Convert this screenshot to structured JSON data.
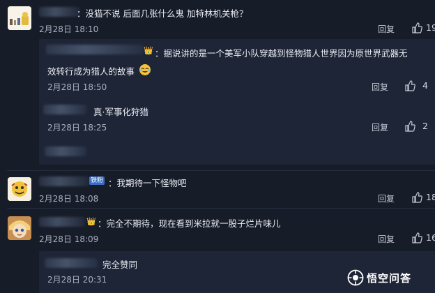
{
  "comments": [
    {
      "text": "：没猫不说 后面几张什么鬼 加特林机关枪？",
      "date": "2月28日 18:10",
      "reply_label": "回复",
      "likes": "19"
    },
    {
      "text": "：我期待一下怪物吧",
      "badge": "铁粉",
      "date": "2月28日 18:08",
      "reply_label": "回复",
      "likes": "18"
    },
    {
      "text": "：完全不期待，现在看到米拉就一股子烂片味儿",
      "date": "2月28日 18:09",
      "reply_label": "回复",
      "likes": "16"
    }
  ],
  "replies_1": [
    {
      "text_line1": "：据说讲的是一个美军小队穿越到怪物猎人世界因为原世界武器无",
      "text_line2": "效转行成为猎人的故事",
      "date": "2月28日 18:50",
      "reply_label": "回复",
      "likes": "4"
    },
    {
      "text": "真·军事化狩猎",
      "date": "2月28日 18:25",
      "reply_label": "回复",
      "likes": "2"
    }
  ],
  "replies_3": [
    {
      "text": "完全赞同",
      "date": "2月28日 20:31"
    }
  ],
  "watermark": {
    "text": "悟空问答"
  }
}
